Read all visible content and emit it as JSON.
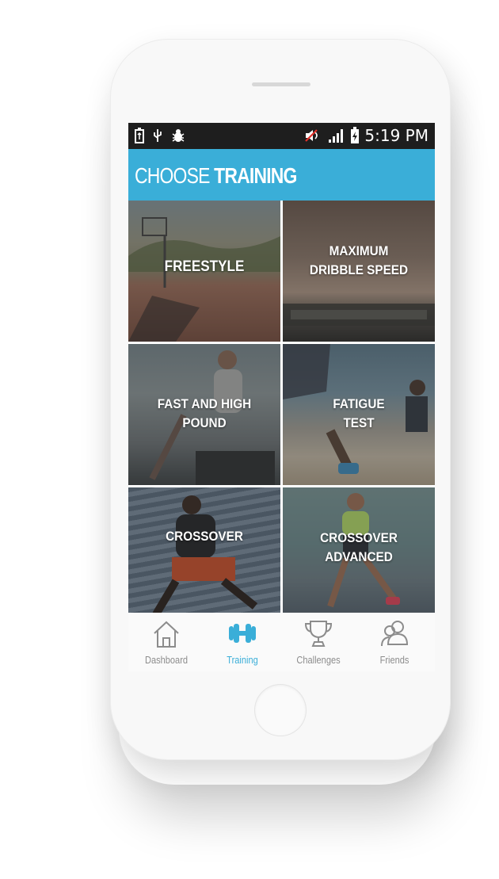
{
  "status_bar": {
    "time": "5:19 PM",
    "icons": [
      "battery-icon",
      "usb-icon",
      "bug-icon",
      "mute-icon",
      "signal-icon",
      "charging-battery-icon"
    ]
  },
  "header": {
    "title_light": "CHOOSE",
    "title_bold": "TRAINING",
    "color": "#3aaed8"
  },
  "tiles": [
    {
      "label": "FREESTYLE",
      "icon": "basketball-court-photo"
    },
    {
      "label": "MAXIMUM\nDRIBBLE SPEED",
      "icon": "feet-on-scale-photo"
    },
    {
      "label": "FAST AND HIGH\nPOUND",
      "icon": "athlete-box-jump-photo"
    },
    {
      "label": "FATIGUE\nTEST",
      "icon": "beach-sprint-photo"
    },
    {
      "label": "CROSSOVER",
      "icon": "stadium-stairs-photo"
    },
    {
      "label": "CROSSOVER\nADVANCED",
      "icon": "woman-running-photo"
    }
  ],
  "tabs": [
    {
      "label": "Dashboard",
      "icon": "home-icon",
      "active": false
    },
    {
      "label": "Training",
      "icon": "dumbbell-icon",
      "active": true
    },
    {
      "label": "Challenges",
      "icon": "trophy-icon",
      "active": false
    },
    {
      "label": "Friends",
      "icon": "friends-icon",
      "active": false
    }
  ],
  "colors": {
    "accent": "#3aaed8",
    "inactive": "#8c8c8c"
  }
}
